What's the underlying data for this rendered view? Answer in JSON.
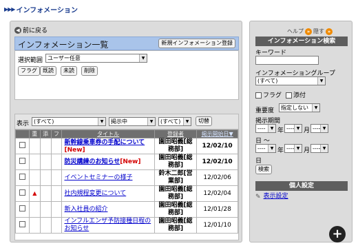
{
  "header": {
    "arrows": "▶▶▶",
    "title": "インフォメーション"
  },
  "left": {
    "back_label": "前に戻る",
    "panel_title": "インフォメーション一覧",
    "new_button": "新規インフォメーション登録",
    "scope_label": "選択範囲",
    "scope_value": "ユーザー任意",
    "actions": [
      "フラグ",
      "既読",
      "未読",
      "削除"
    ],
    "display_label": "表示",
    "display_filter": "(すべて)",
    "status_filter": "掲示中",
    "third_filter": "(すべて)",
    "switch_button": "切替",
    "columns": [
      "",
      "重",
      "添",
      "フ",
      "タイトル",
      "登録者",
      "掲示開始日▼"
    ],
    "rows": [
      {
        "mark": "",
        "title": "新幹線乗車券の手配について",
        "new": "[New]",
        "bold": true,
        "registrant": "園田昭義[総務部]",
        "date": "12/02/10",
        "date_bold": true
      },
      {
        "mark": "",
        "title": "防災講練のお知らせ",
        "new": "[New]",
        "bold": true,
        "registrant": "園田昭義[総務部]",
        "date": "12/02/10",
        "date_bold": true
      },
      {
        "mark": "",
        "title": "イベントセミナーの様子",
        "new": "",
        "bold": false,
        "registrant": "鈴木二郎[営業部]",
        "date": "12/02/06",
        "date_bold": false
      },
      {
        "mark": "▲",
        "title": "社内規程変更について",
        "new": "",
        "bold": false,
        "registrant": "園田昭義[総務部]",
        "date": "12/02/04",
        "date_bold": false
      },
      {
        "mark": "",
        "title": "新入社員の紹介",
        "new": "",
        "bold": false,
        "registrant": "園田昭義[総務部]",
        "date": "12/01/28",
        "date_bold": false
      },
      {
        "mark": "",
        "title": "インフルエンザ予防接種日程のお知らせ",
        "new": "",
        "bold": false,
        "registrant": "園田昭義[総務部]",
        "date": "12/01/10",
        "date_bold": false
      }
    ]
  },
  "right": {
    "help_label": "ヘルプ",
    "hide_label": "隠す",
    "search_title": "インフォメーション検索",
    "keyword_label": "キーワード",
    "group_label": "インフォメーショングループ",
    "group_value": "(すべて)",
    "flag_label": "フラグ",
    "attach_label": "添付",
    "importance_label": "重要度",
    "importance_value": "指定しない",
    "period_label": "掲示期間",
    "dash": "----",
    "year": "年",
    "month": "月",
    "day": "日",
    "tilde": "日 〜",
    "search_button": "検索",
    "personal_title": "個人設定",
    "display_settings": "表示設定"
  }
}
